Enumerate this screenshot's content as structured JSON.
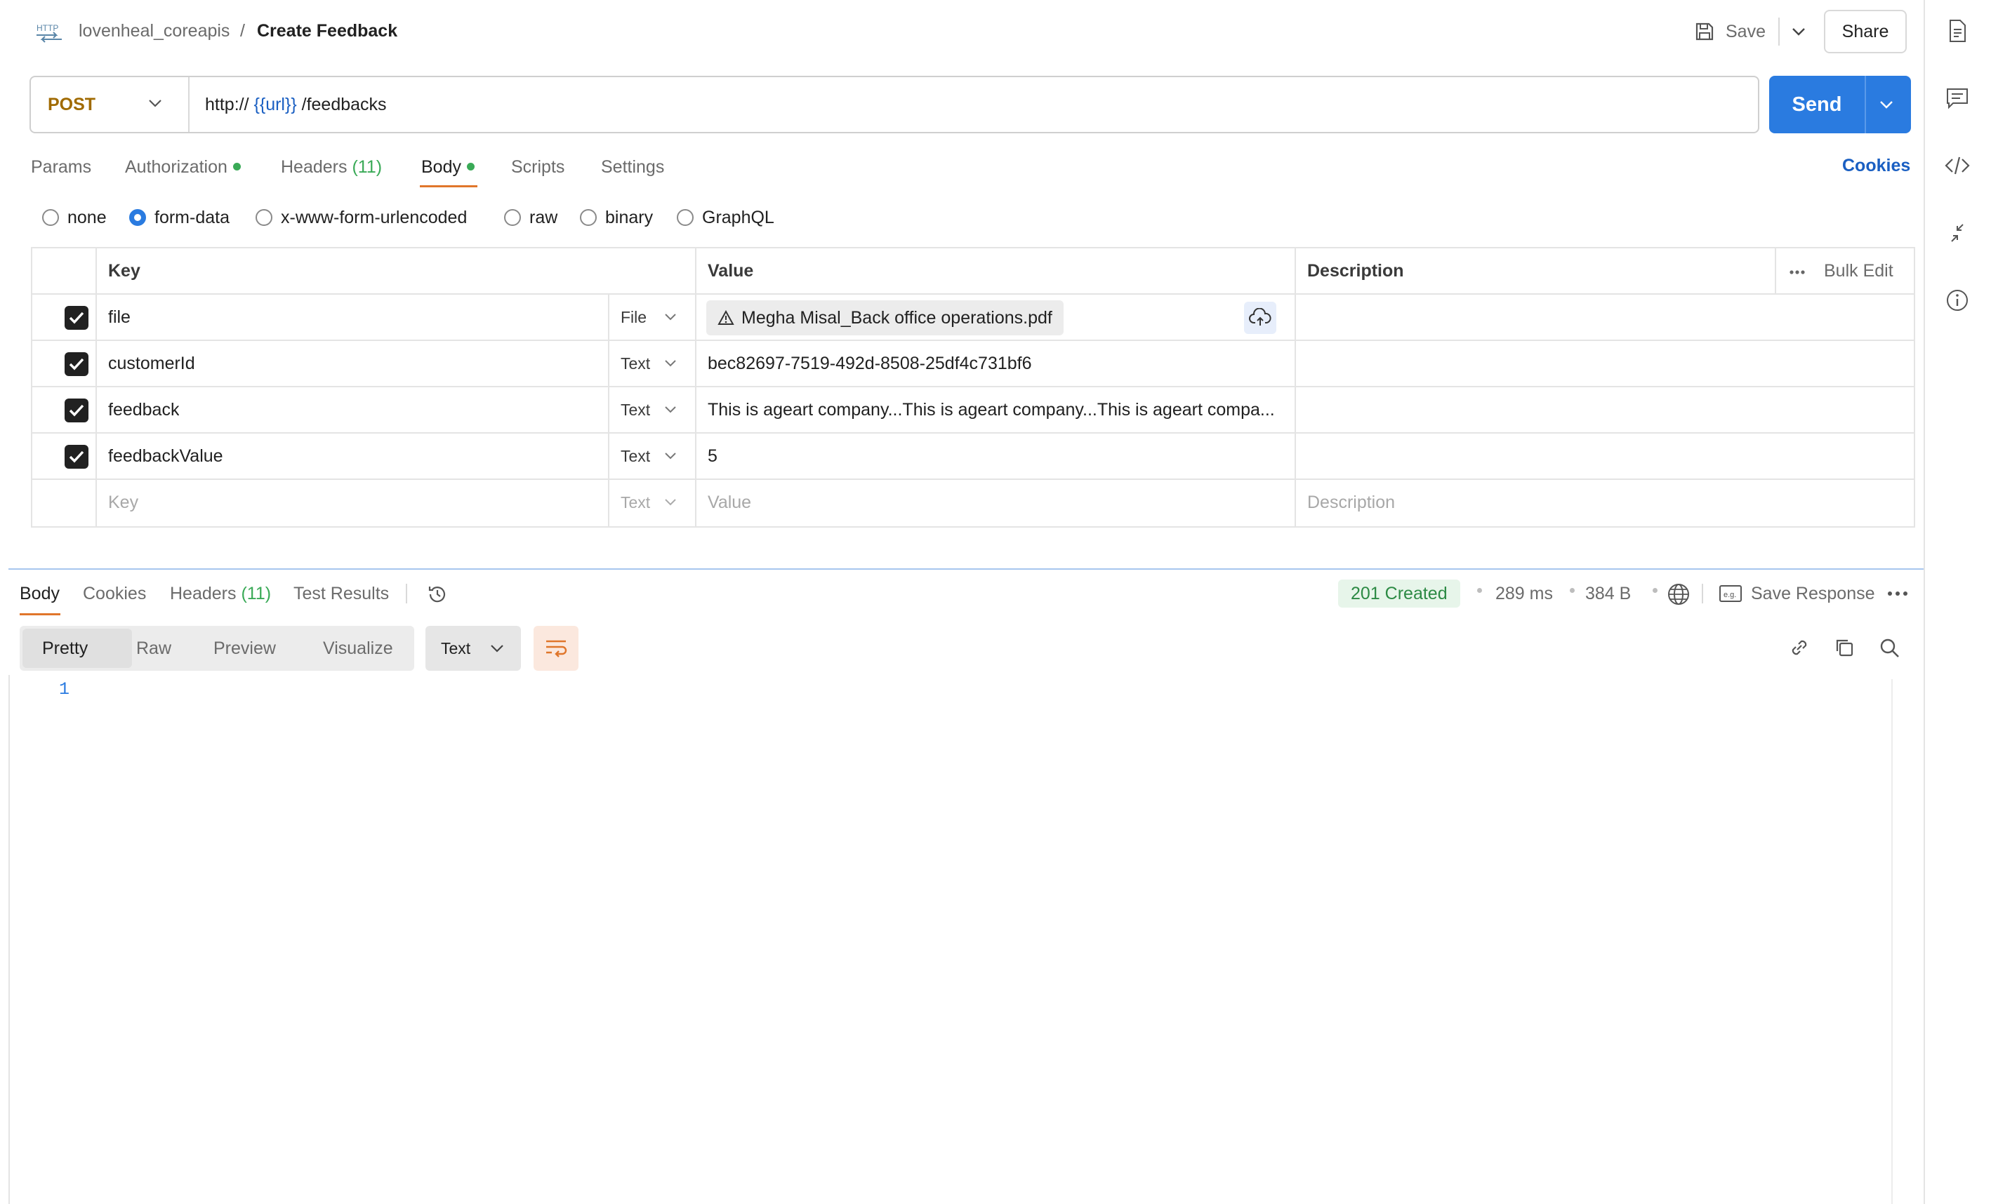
{
  "header": {
    "collection": "lovenheal_coreapis",
    "separator": "/",
    "request_name": "Create Feedback",
    "save_label": "Save",
    "share_label": "Share",
    "icons": [
      "http-icon",
      "save-icon",
      "chevron-down-icon"
    ]
  },
  "url_bar": {
    "method": "POST",
    "url_prefix": "http://",
    "url_variable": "{{url}}",
    "url_path": "/feedbacks",
    "send_label": "Send"
  },
  "request_tabs": {
    "params": "Params",
    "authorization": "Authorization",
    "headers": "Headers",
    "headers_count": "(11)",
    "body": "Body",
    "scripts": "Scripts",
    "settings": "Settings",
    "cookies": "Cookies",
    "active": "Body"
  },
  "body_modes": {
    "none": "none",
    "form_data": "form-data",
    "urlencoded": "x-www-form-urlencoded",
    "raw": "raw",
    "binary": "binary",
    "graphql": "GraphQL",
    "selected": "form-data"
  },
  "form_table": {
    "headers": {
      "key": "Key",
      "value": "Value",
      "description": "Description",
      "bulk_edit": "Bulk Edit"
    },
    "rows": [
      {
        "checked": true,
        "key": "file",
        "type": "File",
        "value": "Megha Misal_Back office operations.pdf",
        "description": ""
      },
      {
        "checked": true,
        "key": "customerId",
        "type": "Text",
        "value": "bec82697-7519-492d-8508-25df4c731bf6",
        "description": ""
      },
      {
        "checked": true,
        "key": "feedback",
        "type": "Text",
        "value": "This is ageart company...This is ageart company...This is ageart compa...",
        "description": ""
      },
      {
        "checked": true,
        "key": "feedbackValue",
        "type": "Text",
        "value": "5",
        "description": ""
      }
    ],
    "empty_row": {
      "key_placeholder": "Key",
      "type": "Text",
      "value_placeholder": "Value",
      "description_placeholder": "Description"
    }
  },
  "response": {
    "tabs": {
      "body": "Body",
      "cookies": "Cookies",
      "headers": "Headers",
      "headers_count": "(11)",
      "test_results": "Test Results"
    },
    "status": "201 Created",
    "time": "289 ms",
    "size": "384 B",
    "save_response": "Save Response",
    "view_modes": {
      "pretty": "Pretty",
      "raw": "Raw",
      "preview": "Preview",
      "visualize": "Visualize",
      "active": "Pretty"
    },
    "language": "Text",
    "line_numbers": [
      "1"
    ]
  },
  "colors": {
    "send": "#2a7be0",
    "method": "#a06a00",
    "active_tab_underline": "#e0762b",
    "status_ok": "#2c8a44",
    "link": "#1a5fc2"
  },
  "right_rail_icons": [
    "document-icon",
    "comment-icon",
    "code-icon",
    "collapse-arrows-icon",
    "info-icon"
  ]
}
